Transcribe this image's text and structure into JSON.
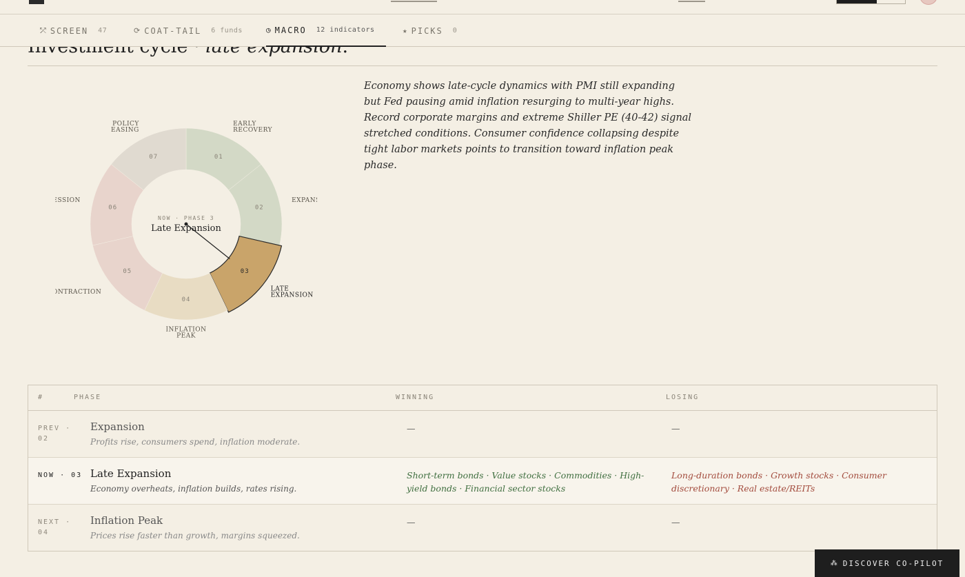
{
  "tabs": [
    {
      "icon": "⤱",
      "label": "SCREEN",
      "count": "47"
    },
    {
      "icon": "⟳",
      "label": "COAT-TAIL",
      "count": "6 funds"
    },
    {
      "icon": "◷",
      "label": "MACRO",
      "count": "12 indicators"
    },
    {
      "icon": "★",
      "label": "PICKS",
      "count": "0"
    }
  ],
  "active_tab": "MACRO",
  "heading": {
    "prefix": "Investment cycle · ",
    "phase": "late expansion",
    "suffix": "."
  },
  "summary": "Economy shows late-cycle dynamics with PMI still expanding but Fed pausing amid inflation resurging to multi-year highs. Record corporate margins and extreme Shiller PE (40-42) signal stretched conditions. Consumer confidence collapsing despite tight labor markets points to transition toward inflation peak phase.",
  "cycle": {
    "current_phase": 3,
    "center_caption": "NOW · PHASE 3",
    "center_title": "Late Expansion",
    "phases": [
      {
        "num": "01",
        "label": [
          "EARLY",
          "RECOVERY"
        ],
        "color": "#d3d9c6"
      },
      {
        "num": "02",
        "label": [
          "EXPANSION"
        ],
        "color": "#d3d9c6"
      },
      {
        "num": "03",
        "label": [
          "LATE",
          "EXPANSION"
        ],
        "color": "#c9a46a"
      },
      {
        "num": "04",
        "label": [
          "INFLATION",
          "PEAK"
        ],
        "color": "#e8dcc3"
      },
      {
        "num": "05",
        "label": [
          "CONTRACTION"
        ],
        "color": "#e8d4cc"
      },
      {
        "num": "06",
        "label": [
          "RECESSION"
        ],
        "color": "#e8d4cc"
      },
      {
        "num": "07",
        "label": [
          "POLICY",
          "EASING"
        ],
        "color": "#e0dad0"
      }
    ]
  },
  "table": {
    "headers": {
      "num": "#",
      "phase": "PHASE",
      "winning": "WINNING",
      "losing": "LOSING"
    },
    "rows": [
      {
        "idx": "PREV · 02",
        "name": "Expansion",
        "desc": "Profits rise, consumers spend, inflation moderate.",
        "winning": "—",
        "losing": "—",
        "current": false
      },
      {
        "idx": "NOW · 03",
        "name": "Late Expansion",
        "desc": "Economy overheats, inflation builds, rates rising.",
        "winning": "Short-term bonds · Value stocks · Commodities · High-yield bonds · Financial sector stocks",
        "losing": "Long-duration bonds · Growth stocks · Consumer discretionary · Real estate/REITs",
        "current": true
      },
      {
        "idx": "NEXT · 04",
        "name": "Inflation Peak",
        "desc": "Prices rise faster than growth, margins squeezed.",
        "winning": "—",
        "losing": "—",
        "current": false
      }
    ]
  },
  "copilot": {
    "icon": "⁂",
    "label": "DISCOVER CO-PILOT"
  }
}
